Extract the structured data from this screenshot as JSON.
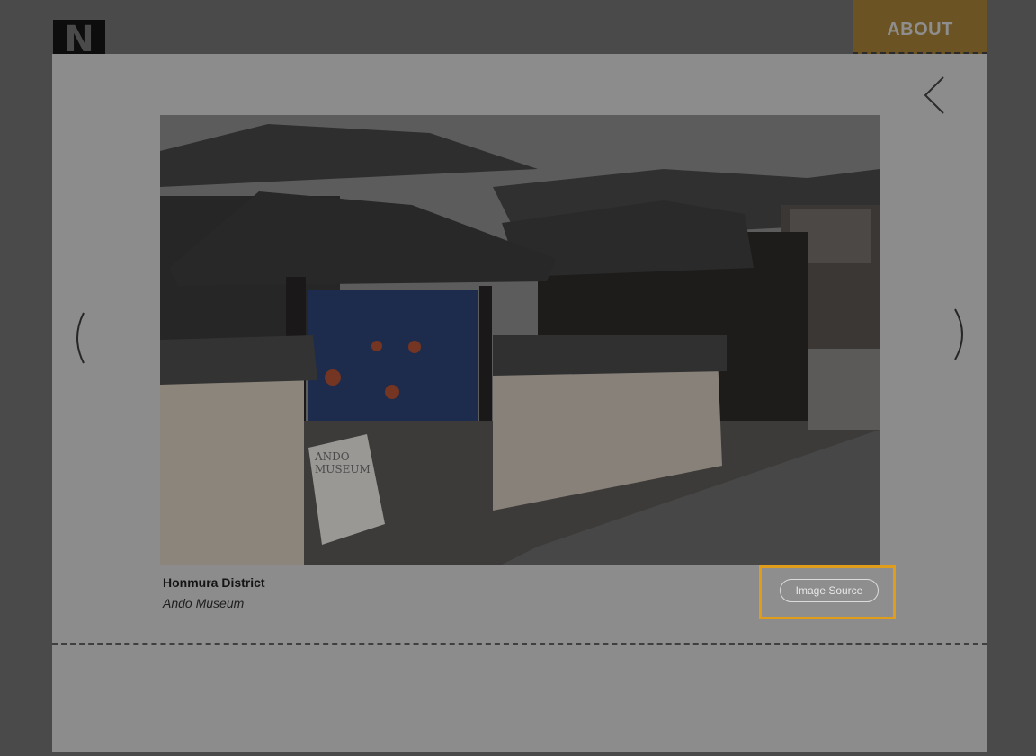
{
  "header": {
    "logo_letter": "N",
    "about_label": "ABOUT"
  },
  "lightbox": {
    "close_icon": "chevron-left-icon",
    "prev_icon": "chevron-left-icon",
    "next_icon": "chevron-right-icon",
    "caption_title": "Honmura District",
    "caption_subtitle": "Ando Museum",
    "source_button_label": "Image Source",
    "photo_sign_line1": "ANDO",
    "photo_sign_line2": "MUSEUM",
    "highlight_color": "#e09d1c"
  }
}
